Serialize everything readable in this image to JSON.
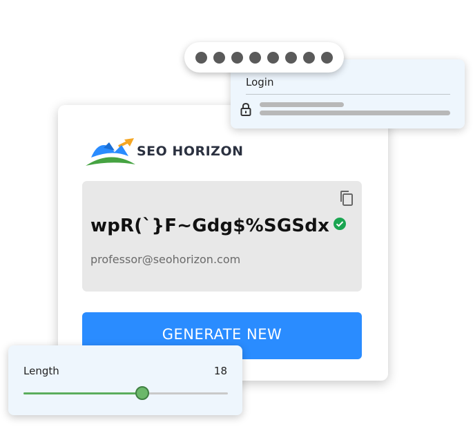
{
  "brand": {
    "name": "SEO HORIZON",
    "colors": {
      "text": "#2b3140",
      "blue": "#2a8cff",
      "green": "#46a342",
      "orange": "#f5a623"
    }
  },
  "password_panel": {
    "password": "wpR(`}F~Gdg$%SGSdx",
    "email": "professor@seohorizon.com",
    "copy_icon": "copy-icon",
    "status_icon": "check-circle-icon",
    "status_color": "#1aa551"
  },
  "actions": {
    "generate_label": "GENERATE NEW",
    "generate_color": "#2a8cff"
  },
  "login_card": {
    "label": "Login",
    "lock_icon": "lock-icon",
    "masked_dot_count": 8
  },
  "length_card": {
    "label": "Length",
    "value": "18",
    "slider_fraction": 0.58
  }
}
